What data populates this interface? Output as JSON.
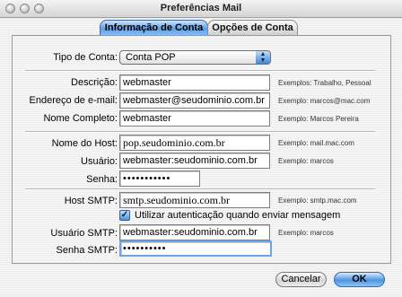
{
  "window": {
    "title": "Preferências Mail"
  },
  "tabs": [
    {
      "label": "Informação de Conta",
      "active": true
    },
    {
      "label": "Opções de Conta",
      "active": false
    }
  ],
  "account_type": {
    "label": "Tipo de Conta:",
    "value": "Conta POP"
  },
  "fields": {
    "description": {
      "label": "Descrição:",
      "value": "webmaster",
      "hint": "Exemplos: Trabalho, Pessoal"
    },
    "email": {
      "label": "Endereço de e-mail:",
      "value": "webmaster@seudominio.com.br",
      "hint": "Exemplo: marcos@mac.com"
    },
    "full_name": {
      "label": "Nome Completo:",
      "value": "webmaster",
      "hint": "Exemplo: Marcos Pereira"
    },
    "host": {
      "label": "Nome do Host:",
      "value": "pop.seudominio.com.br",
      "hint": "Exemplo: mail.mac.com"
    },
    "user": {
      "label": "Usuário:",
      "value": "webmaster:seudominio.com.br",
      "hint": "Exemplo: marcos"
    },
    "password": {
      "label": "Senha:",
      "value": "•••••••••••"
    },
    "smtp_host": {
      "label": "Host SMTP:",
      "value": "smtp.seudominio.com.br",
      "hint": "Exemplo: smtp.mac.com"
    },
    "smtp_user": {
      "label": "Usuário SMTP:",
      "value": "webmaster:seudominio.com.br",
      "hint": "Exemplo: marcos"
    },
    "smtp_password": {
      "label": "Senha SMTP:",
      "value": "••••••••••"
    }
  },
  "smtp_auth": {
    "label": "Utilizar autenticação quando enviar mensagem",
    "checked": true
  },
  "buttons": {
    "cancel": "Cancelar",
    "ok": "OK"
  }
}
